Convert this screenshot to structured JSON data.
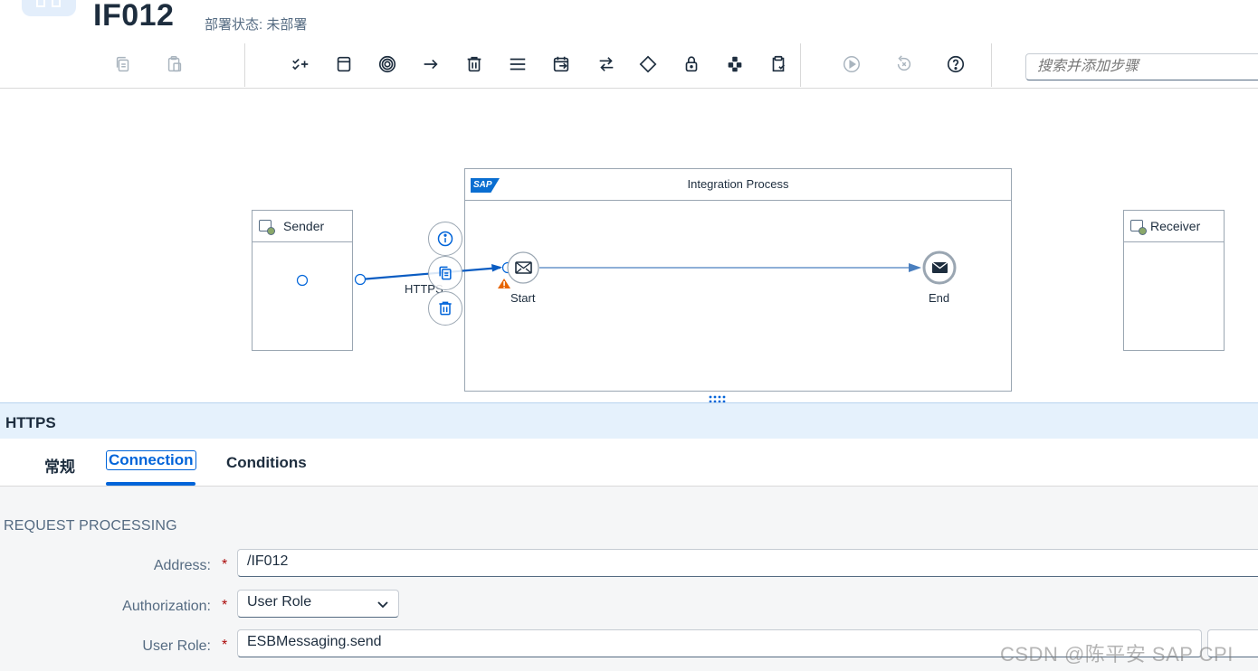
{
  "header": {
    "title": "IF012",
    "deploy_status": "部署状态: 未部署"
  },
  "toolbar": {
    "search_placeholder": "搜索并添加步骤",
    "buttons": [
      {
        "icon": "copy-icon",
        "enabled": false
      },
      {
        "icon": "paste-icon",
        "enabled": false
      },
      {
        "icon": "add-step-icon",
        "enabled": true
      },
      {
        "icon": "participant-icon",
        "enabled": true
      },
      {
        "icon": "events-icon",
        "enabled": true
      },
      {
        "icon": "connect-icon",
        "enabled": true
      },
      {
        "icon": "delete-icon",
        "enabled": true
      },
      {
        "icon": "menu-icon",
        "enabled": true
      },
      {
        "icon": "call-icon",
        "enabled": true
      },
      {
        "icon": "transform-icon",
        "enabled": true
      },
      {
        "icon": "routing-icon",
        "enabled": true
      },
      {
        "icon": "security-icon",
        "enabled": true
      },
      {
        "icon": "persistence-icon",
        "enabled": true
      },
      {
        "icon": "validator-icon",
        "enabled": true
      },
      {
        "icon": "simulate-icon",
        "enabled": false
      },
      {
        "icon": "reset-icon",
        "enabled": false
      },
      {
        "icon": "help-icon",
        "enabled": true
      }
    ]
  },
  "canvas": {
    "sender_label": "Sender",
    "receiver_label": "Receiver",
    "process_label": "Integration Process",
    "sap_logo": "SAP",
    "start_label": "Start",
    "end_label": "End",
    "connection_label": "HTTPS"
  },
  "panel": {
    "title": "HTTPS",
    "tabs": [
      {
        "label": "常规",
        "active": false
      },
      {
        "label": "Connection",
        "active": true
      },
      {
        "label": "Conditions",
        "active": false
      }
    ],
    "section_title": "REQUEST PROCESSING",
    "fields": {
      "address_label": "Address:",
      "address_value": "/IF012",
      "authorization_label": "Authorization:",
      "authorization_value": "User Role",
      "user_role_label": "User Role:",
      "user_role_value": "ESBMessaging.send",
      "required_marker": "*"
    }
  },
  "watermark": "CSDN @陈平安 SAP CPI",
  "colors": {
    "accent": "#0064d9",
    "panel_header_bg": "#e5f1fc",
    "warning": "#e76500",
    "required": "#aa0808"
  }
}
